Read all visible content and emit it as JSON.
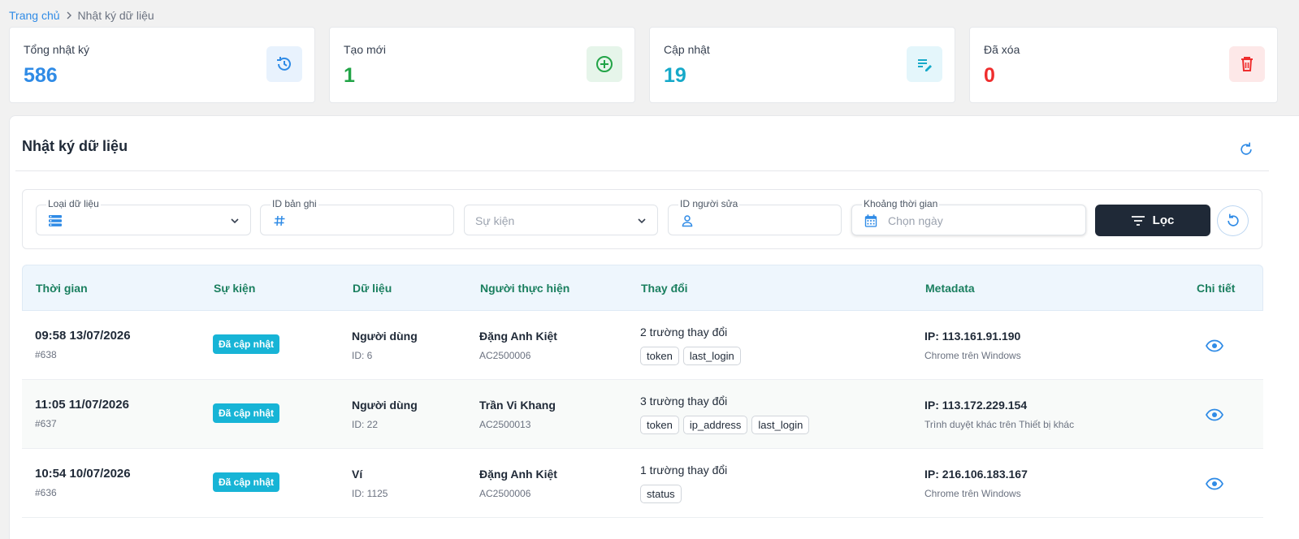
{
  "breadcrumb": {
    "home": "Trang chủ",
    "current": "Nhật ký dữ liệu"
  },
  "stats": [
    {
      "title": "Tổng nhật ký",
      "value": "586",
      "color": "#2f8be6",
      "icon": "history-icon",
      "icon_bg": "#e8f2fd"
    },
    {
      "title": "Tạo mới",
      "value": "1",
      "color": "#22a447",
      "icon": "add-circle-icon",
      "icon_bg": "#e6f5ea"
    },
    {
      "title": "Cập nhật",
      "value": "19",
      "color": "#16a9c9",
      "icon": "edit-list-icon",
      "icon_bg": "#e4f6fb"
    },
    {
      "title": "Đã xóa",
      "value": "0",
      "color": "#ef2d2d",
      "icon": "trash-icon",
      "icon_bg": "#fde8e8"
    }
  ],
  "panel": {
    "title": "Nhật ký dữ liệu"
  },
  "filters": {
    "data_type_label": "Loại dữ liệu",
    "record_id_label": "ID bản ghi",
    "event_placeholder": "Sự kiện",
    "editor_id_label": "ID người sửa",
    "time_range_label": "Khoảng thời gian",
    "date_placeholder": "Chọn ngày",
    "filter_button": "Lọc"
  },
  "table": {
    "headers": {
      "time": "Thời gian",
      "event": "Sự kiện",
      "data": "Dữ liệu",
      "actor": "Người thực hiện",
      "changes": "Thay đổi",
      "metadata": "Metadata",
      "detail": "Chi tiết"
    },
    "rows": [
      {
        "time": "09:58 13/07/2026",
        "id": "#638",
        "event": "Đã cập nhật",
        "data": "Người dùng",
        "data_id": "ID: 6",
        "actor": "Đặng Anh Kiệt",
        "actor_code": "AC2500006",
        "changes": "2 trường thay đổi",
        "fields": [
          "token",
          "last_login"
        ],
        "ip": "IP: 113.161.91.190",
        "agent": "Chrome trên Windows"
      },
      {
        "time": "11:05 11/07/2026",
        "id": "#637",
        "event": "Đã cập nhật",
        "data": "Người dùng",
        "data_id": "ID: 22",
        "actor": "Trần Vi Khang",
        "actor_code": "AC2500013",
        "changes": "3 trường thay đổi",
        "fields": [
          "token",
          "ip_address",
          "last_login"
        ],
        "ip": "IP: 113.172.229.154",
        "agent": "Trình duyệt khác trên Thiết bị khác"
      },
      {
        "time": "10:54 10/07/2026",
        "id": "#636",
        "event": "Đã cập nhật",
        "data": "Ví",
        "data_id": "ID: 1125",
        "actor": "Đặng Anh Kiệt",
        "actor_code": "AC2500006",
        "changes": "1 trường thay đổi",
        "fields": [
          "status"
        ],
        "ip": "IP: 216.106.183.167",
        "agent": "Chrome trên Windows"
      }
    ]
  }
}
